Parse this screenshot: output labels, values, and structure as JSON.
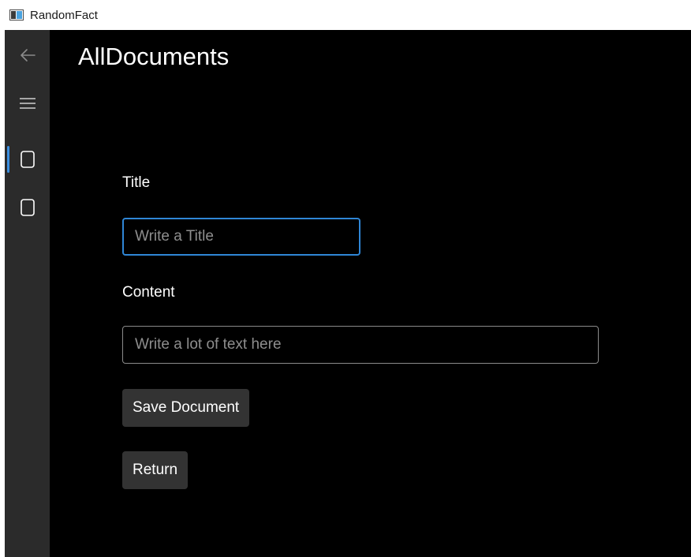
{
  "window": {
    "title": "RandomFact"
  },
  "nav": {
    "back_icon": "arrow-left-icon",
    "menu_icon": "hamburger-menu-icon",
    "items": [
      {
        "icon": "document-icon",
        "selected": true
      },
      {
        "icon": "document-icon",
        "selected": false
      }
    ],
    "accent_color": "#3c8fe0"
  },
  "page": {
    "title": "AllDocuments",
    "title_field": {
      "label": "Title",
      "placeholder": "Write a Title",
      "value": ""
    },
    "content_field": {
      "label": "Content",
      "placeholder": "Write a lot of text here",
      "value": ""
    },
    "save_button": "Save Document",
    "return_button": "Return"
  },
  "colors": {
    "background": "#000000",
    "nav_background": "#2b2b2b",
    "focus_border": "#2f86d6",
    "button_background": "#333333"
  }
}
